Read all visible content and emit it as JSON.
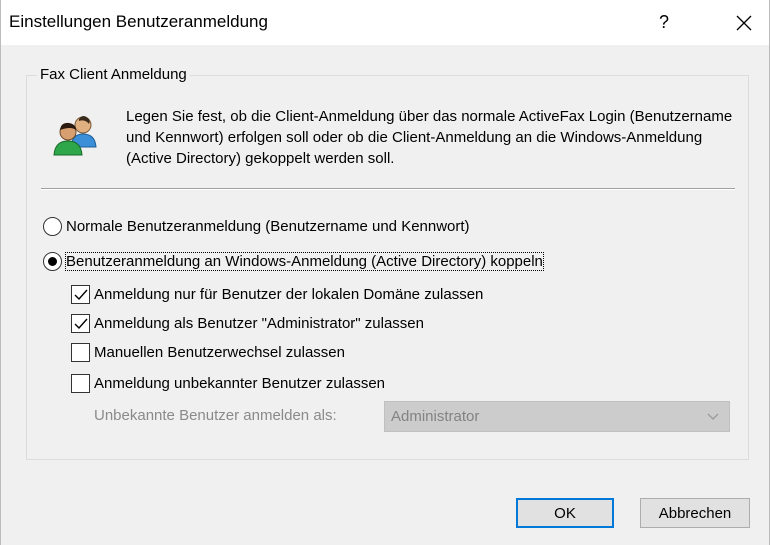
{
  "window": {
    "title": "Einstellungen Benutzeranmeldung",
    "help_label": "?"
  },
  "group": {
    "title": "Fax Client Anmeldung",
    "description": "Legen Sie fest, ob die Client-Anmeldung über das normale ActiveFax Login (Benutzername und Kennwort) erfolgen soll oder ob die Client-Anmeldung an die Windows-Anmeldung (Active Directory) gekoppelt werden soll."
  },
  "options": {
    "radio_normal": {
      "label": "Normale Benutzeranmeldung (Benutzername und Kennwort)",
      "selected": false
    },
    "radio_windows": {
      "label": "Benutzeranmeldung an Windows-Anmeldung (Active Directory) koppeln",
      "selected": true
    },
    "checkboxes": [
      {
        "label": "Anmeldung nur für Benutzer der lokalen Domäne zulassen",
        "checked": true
      },
      {
        "label": "Anmeldung als Benutzer \"Administrator\" zulassen",
        "checked": true
      },
      {
        "label": "Manuellen Benutzerwechsel zulassen",
        "checked": false
      },
      {
        "label": "Anmeldung unbekannter Benutzer zulassen",
        "checked": false
      }
    ],
    "unknown_user_label": "Unbekannte Benutzer anmelden als:",
    "unknown_user_value": "Administrator"
  },
  "buttons": {
    "ok": "OK",
    "cancel": "Abbrechen"
  },
  "colors": {
    "accent": "#0078d7",
    "face": "#f0f0f0"
  },
  "icons": {
    "title_close": "close-icon",
    "group": "users-icon",
    "combo": "chevron-down-icon",
    "check": "checkmark-icon"
  }
}
